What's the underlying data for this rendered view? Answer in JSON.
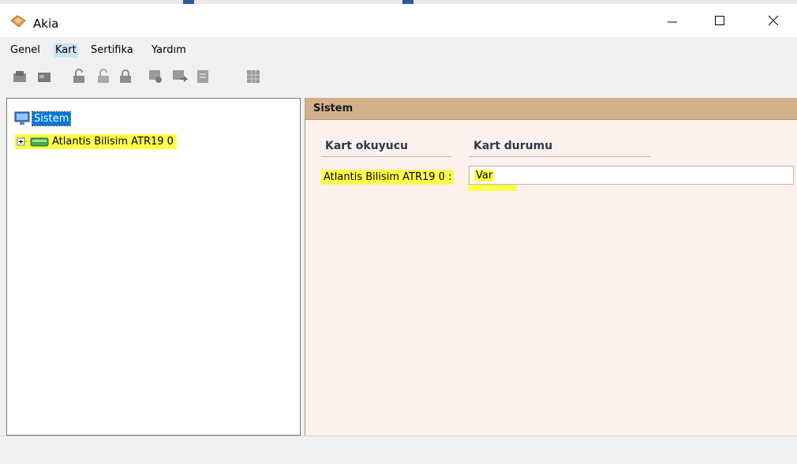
{
  "window": {
    "title": "Akia"
  },
  "menu": {
    "items": [
      "Genel",
      "Kart",
      "Sertifika",
      "Yardım"
    ]
  },
  "toolbar": {
    "icons": [
      "card-reader-icon",
      "card-icon",
      "unlock-icon",
      "lock-open-icon",
      "lock-icon",
      "certificate-icon",
      "certificate-export-icon",
      "document-icon",
      "grid-icon"
    ]
  },
  "tree": {
    "root": {
      "label": "Sistem",
      "icon": "computer-icon"
    },
    "child": {
      "label": "Atlantis Bilisim ATR19 0",
      "icon": "card-reader-icon"
    }
  },
  "detail": {
    "title": "Sistem",
    "col_reader": "Kart okuyucu",
    "col_status": "Kart durumu",
    "row_label": "Atlantis Bilisim ATR19 0 :",
    "row_value": "Var"
  },
  "colors": {
    "header": "#d2b08a",
    "panel": "#fdf1ed",
    "highlight": "#fcff4a",
    "selection": "#0078d7"
  }
}
